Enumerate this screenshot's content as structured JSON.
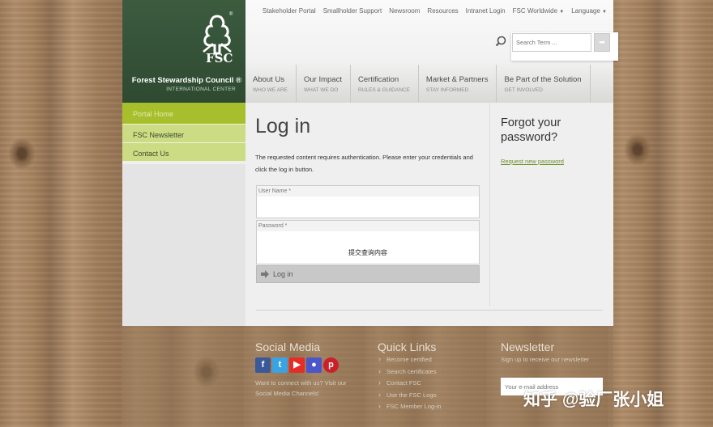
{
  "brand": {
    "logo_text": "FSC",
    "org_name": "Forest Stewardship Council ®",
    "org_sub": "INTERNATIONAL CENTER"
  },
  "topnav": [
    "Stakeholder Portal",
    "Smallholder Support",
    "Newsroom",
    "Resources",
    "Intranet Login",
    "FSC Worldwide",
    "Language"
  ],
  "search": {
    "placeholder": "Search Term ..."
  },
  "mainnav": [
    {
      "title": "About Us",
      "sub": "WHO WE ARE"
    },
    {
      "title": "Our Impact",
      "sub": "WHAT WE DO"
    },
    {
      "title": "Certification",
      "sub": "RULES & GUIDANCE"
    },
    {
      "title": "Market & Partners",
      "sub": "STAY INFORMED"
    },
    {
      "title": "Be Part of the Solution",
      "sub": "GET INVOLVED"
    }
  ],
  "sidebar": [
    "Portal Home",
    "FSC Newsletter",
    "Contact Us"
  ],
  "login": {
    "title": "Log in",
    "description": "The requested content requires authentication. Please enter your credentials and click the log in button.",
    "username_label": "User Name *",
    "password_label": "Password *",
    "overlay_text": "提交查询内容",
    "button_label": "Log in"
  },
  "forgot": {
    "title": "Forgot your password?",
    "link": "Request new password"
  },
  "footer": {
    "social_heading": "Social Media",
    "social_text": "Want to connect with us? Visit our Social Media Channels!",
    "quick_heading": "Quick Links",
    "quick_links": [
      "Become certified",
      "Search certificates",
      "Contact FSC",
      "Use the FSC Logo",
      "FSC Member Log-in"
    ],
    "news_heading": "Newsletter",
    "news_sub": "Sign up to receive our newsletter",
    "email_placeholder": "Your e-mail address"
  },
  "watermark": "知乎 @验厂张小姐",
  "colors": {
    "brand_green": "#2e4a31",
    "sidebar_active": "#a8bf2d",
    "sidebar_item": "#cbdc85",
    "link_green": "#6e8f2a"
  }
}
